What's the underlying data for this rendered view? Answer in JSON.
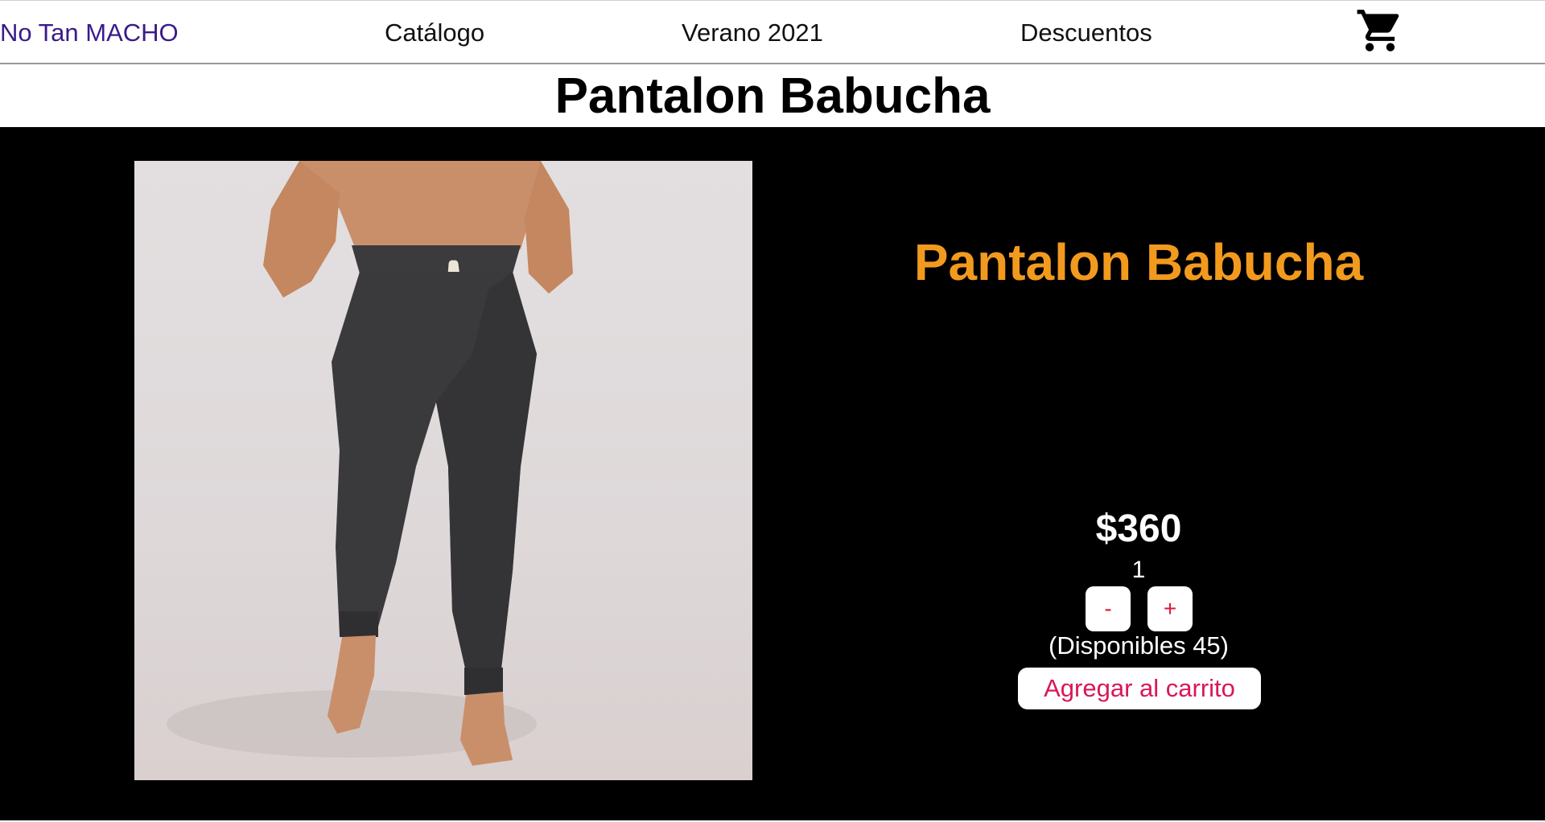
{
  "nav": {
    "brand": "No Tan MACHO",
    "links": [
      "Catálogo",
      "Verano 2021",
      "Descuentos"
    ],
    "cart_icon": "shopping-cart-icon"
  },
  "page": {
    "title": "Pantalon Babucha"
  },
  "product": {
    "name": "Pantalon Babucha",
    "price": "$360",
    "quantity": "1",
    "decrement_label": "-",
    "increment_label": "+",
    "availability": "(Disponibles 45)",
    "add_to_cart_label": "Agregar al carrito"
  },
  "colors": {
    "brand": "#3a1a8c",
    "product_name": "#f29a1e",
    "button_text": "#e0163a",
    "section_background": "#000000"
  }
}
